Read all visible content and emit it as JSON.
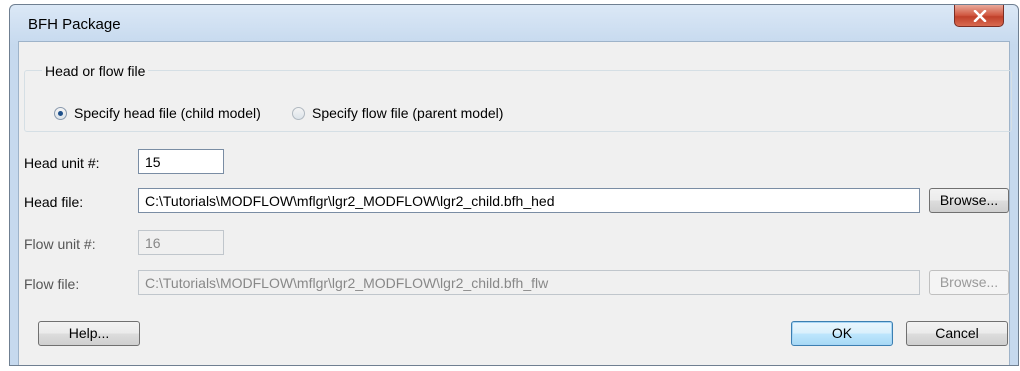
{
  "window": {
    "title": "BFH Package"
  },
  "group": {
    "legend": "Head or flow file",
    "radio_head_label": "Specify head file (child model)",
    "radio_flow_label": "Specify flow file (parent model)",
    "selected": "head"
  },
  "head_unit": {
    "label": "Head unit #:",
    "value": "15"
  },
  "head_file": {
    "label": "Head file:",
    "value": "C:\\Tutorials\\MODFLOW\\mflgr\\lgr2_MODFLOW\\lgr2_child.bfh_hed",
    "browse_label": "Browse..."
  },
  "flow_unit": {
    "label": "Flow unit #:",
    "value": "16"
  },
  "flow_file": {
    "label": "Flow file:",
    "value": "C:\\Tutorials\\MODFLOW\\mflgr\\lgr2_MODFLOW\\lgr2_child.bfh_flw",
    "browse_label": "Browse..."
  },
  "buttons": {
    "help": "Help...",
    "ok": "OK",
    "cancel": "Cancel"
  },
  "icons": {
    "close": "close-icon"
  }
}
